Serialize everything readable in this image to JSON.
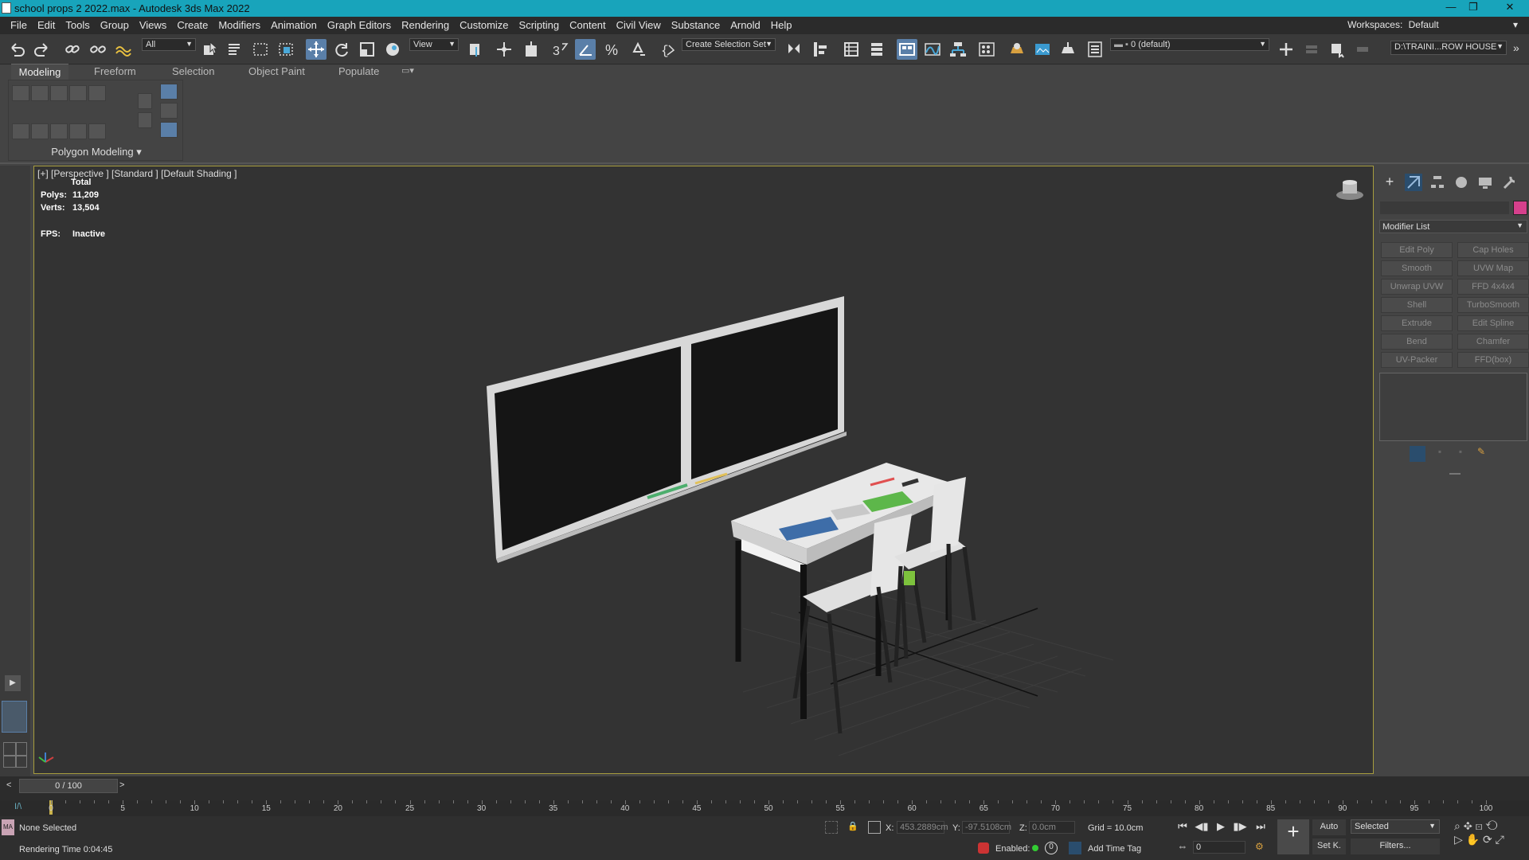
{
  "window": {
    "title": "school props 2 2022.max - Autodesk 3ds Max 2022",
    "controls": [
      "—",
      "❐",
      "✕"
    ]
  },
  "menu": [
    "File",
    "Edit",
    "Tools",
    "Group",
    "Views",
    "Create",
    "Modifiers",
    "Animation",
    "Graph Editors",
    "Rendering",
    "Customize",
    "Scripting",
    "Content",
    "Civil View",
    "Substance",
    "Arnold",
    "Help"
  ],
  "workspace": {
    "label": "Workspaces:",
    "value": "Default"
  },
  "toolbar": {
    "selection_filter": "All",
    "ref_coord": "View",
    "named_selection": "Create Selection Set",
    "layer": "0 (default)",
    "project_path": "D:\\TRAINI...ROW HOUSE"
  },
  "ribbon": {
    "tabs": [
      "Modeling",
      "Freeform",
      "Selection",
      "Object Paint",
      "Populate"
    ],
    "panel_label": "Polygon Modeling"
  },
  "viewport": {
    "label": "[+] [Perspective ] [Standard ] [Default Shading ]",
    "stats": {
      "header": "Total",
      "polys_label": "Polys:",
      "polys": "11,209",
      "verts_label": "Verts:",
      "verts": "13,504",
      "fps_label": "FPS:",
      "fps": "Inactive"
    }
  },
  "command_panel": {
    "modifier_list": "Modifier List",
    "modifiers": [
      "Edit Poly",
      "Cap Holes",
      "Smooth",
      "UVW Map",
      "Unwrap UVW",
      "FFD 4x4x4",
      "Shell",
      "TurboSmooth",
      "Extrude",
      "Edit Spline",
      "Bend",
      "Chamfer",
      "UV-Packer",
      "FFD(box)"
    ],
    "color_swatch": "#d6408c"
  },
  "timeline": {
    "frame": "0 / 100",
    "ticks": [
      "0",
      "5",
      "10",
      "15",
      "20",
      "25",
      "30",
      "35",
      "40",
      "45",
      "50",
      "55",
      "60",
      "65",
      "70",
      "75",
      "80",
      "85",
      "90",
      "95",
      "100"
    ]
  },
  "status": {
    "selection": "None Selected",
    "render_time": "Rendering Time  0:04:45",
    "x_label": "X:",
    "x": "453.2889cm",
    "y_label": "Y:",
    "y": "-97.5108cm",
    "z_label": "Z:",
    "z": "0.0cm",
    "grid": "Grid = 10.0cm",
    "enabled": "Enabled:",
    "add_time_tag": "Add Time Tag",
    "auto": "Auto",
    "selected": "Selected",
    "set_key": "Set K.",
    "filters": "Filters...",
    "frame_field": "0",
    "maxscript": "MA"
  }
}
